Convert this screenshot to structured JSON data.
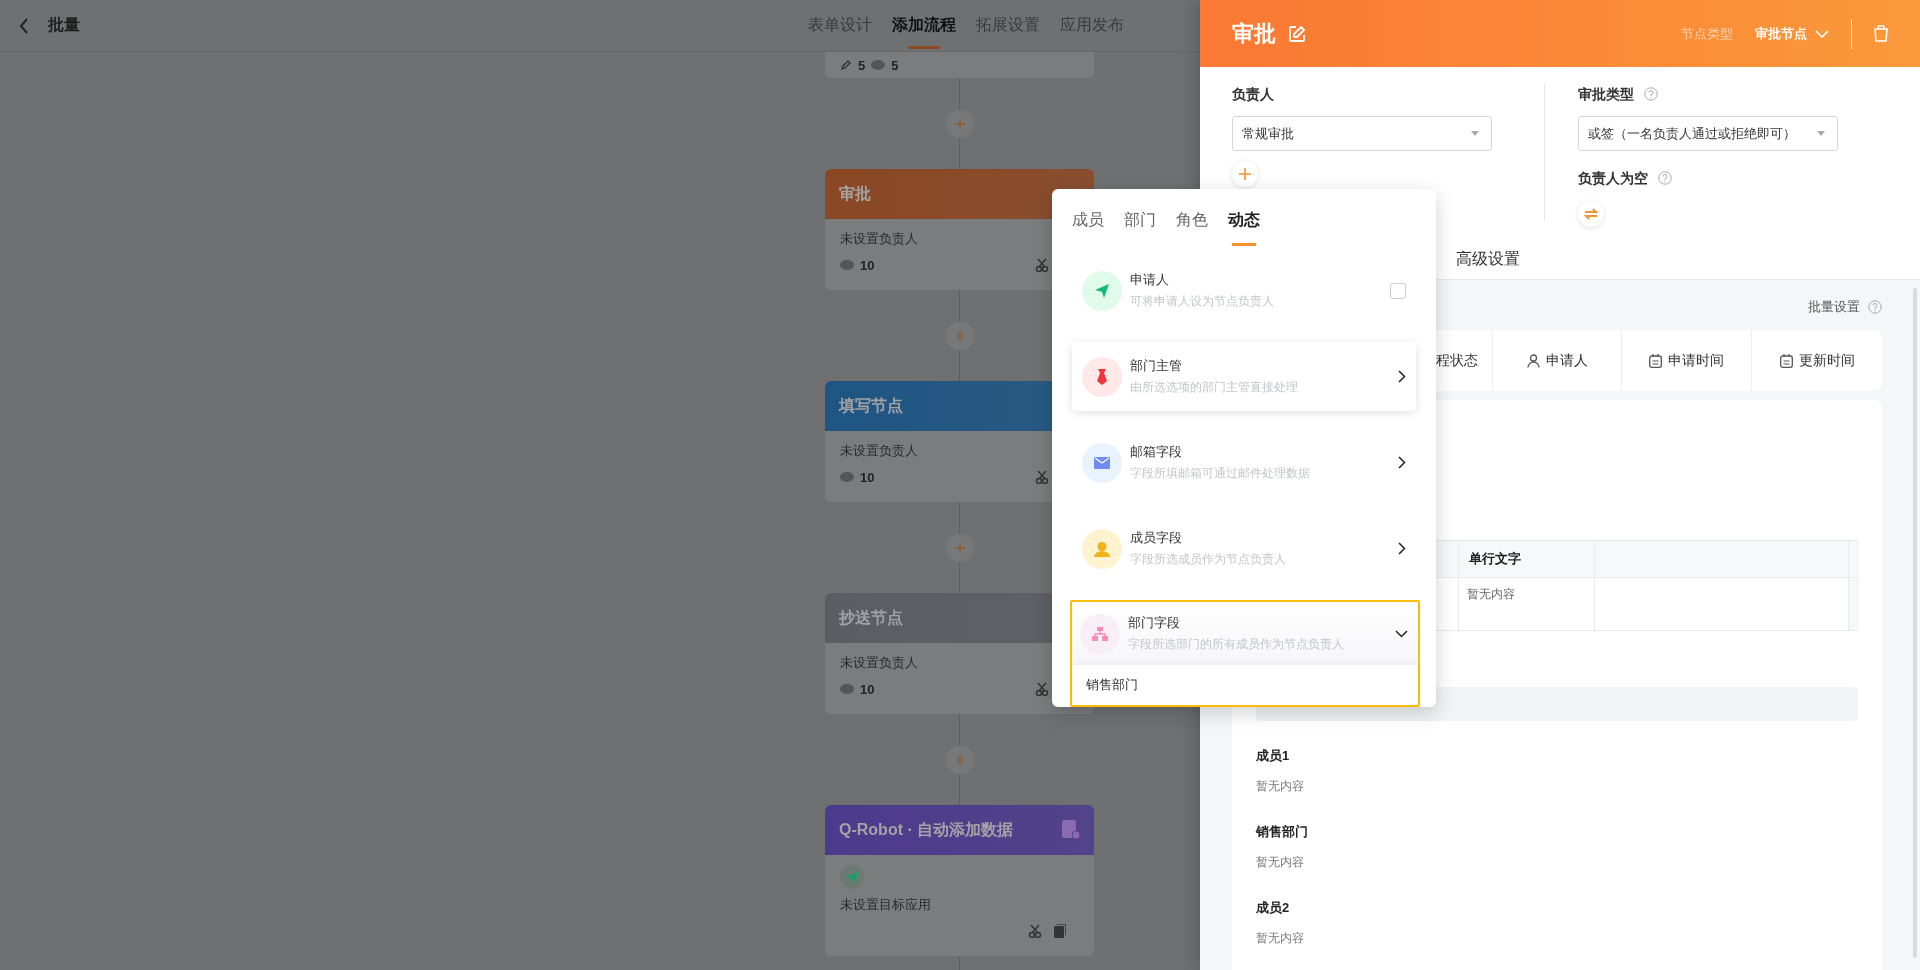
{
  "header": {
    "title": "批量",
    "tabs": [
      {
        "label": "表单设计",
        "selected": false
      },
      {
        "label": "添加流程",
        "selected": true
      },
      {
        "label": "拓展设置",
        "selected": false
      },
      {
        "label": "应用发布",
        "selected": false
      }
    ]
  },
  "flow": {
    "top_card": {
      "edit_count": "5",
      "view_count": "5"
    },
    "nodes": [
      {
        "kind": "approval",
        "title": "审批",
        "color": "#8a4723",
        "subtitle": "未设置负责人",
        "view_count": "10"
      },
      {
        "kind": "fill",
        "title": "填写节点",
        "color": "#1f5583",
        "subtitle": "未设置负责人",
        "view_count": "10"
      },
      {
        "kind": "cc",
        "title": "抄送节点",
        "color": "#5b5d63",
        "subtitle": "未设置负责人",
        "view_count": "10"
      },
      {
        "kind": "robot",
        "title": "Q-Robot · 自动添加数据",
        "color": "#4c3a8c",
        "subtitle": "未设置目标应用"
      }
    ]
  },
  "panel": {
    "title": "审批",
    "node_type_label": "节点类型",
    "node_type": "审批节点",
    "assignee": {
      "label": "负责人",
      "value": "常规审批"
    },
    "approval_type": {
      "label": "审批类型",
      "value": "或签（一名负责人通过或拒绝即可）"
    },
    "empty_assignee": {
      "label": "负责人为空"
    },
    "tabs": [
      {
        "label": "高级设置",
        "selected": false
      }
    ],
    "batch_setting": "批量设置",
    "columns": [
      {
        "kind": "text",
        "label": "程状态"
      },
      {
        "kind": "user",
        "label": "申请人"
      },
      {
        "kind": "date",
        "label": "申请时间"
      },
      {
        "kind": "date",
        "label": "更新时间"
      }
    ],
    "table": {
      "columns": [
        "单行文字"
      ],
      "rows": [
        [
          "暂无内容"
        ]
      ]
    },
    "fields": [
      {
        "label": "成员1",
        "value": "暂无内容"
      },
      {
        "label": "销售部门",
        "value": "暂无内容"
      },
      {
        "label": "成员2",
        "value": "暂无内容"
      }
    ]
  },
  "picker": {
    "tabs": [
      {
        "label": "成员",
        "selected": false
      },
      {
        "label": "部门",
        "selected": false
      },
      {
        "label": "角色",
        "selected": false
      },
      {
        "label": "动态",
        "selected": true
      }
    ],
    "options": [
      {
        "kind": "checkbox",
        "title": "申请人",
        "description": "可将申请人设为节点负责人",
        "color": "#e0faec",
        "checked": false,
        "hovered": false
      },
      {
        "kind": "submenu",
        "title": "部门主管",
        "description": "由所选选项的部门主管直接处理",
        "color": "#ffe8e8",
        "hovered": true
      },
      {
        "kind": "submenu",
        "title": "邮箱字段",
        "description": "字段所填邮箱可通过邮件处理数据",
        "color": "#e9f3ff",
        "hovered": false
      },
      {
        "kind": "submenu",
        "title": "成员字段",
        "description": "字段所选成员作为节点负责人",
        "color": "#fff2cf",
        "hovered": false
      },
      {
        "kind": "dropdown",
        "title": "部门字段",
        "description": "字段所选部门的所有成员作为节点负责人",
        "color": "#f8eef5",
        "hovered": false,
        "expanded": true,
        "children": [
          {
            "label": "销售部门"
          }
        ]
      }
    ]
  }
}
